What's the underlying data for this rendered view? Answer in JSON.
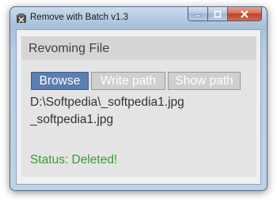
{
  "window": {
    "title": "Remove with Batch v1.3",
    "icon": "app-icon",
    "caption_buttons": {
      "minimize": "minimize-icon",
      "maximize": "maximize-icon",
      "close": "close-icon"
    }
  },
  "header": {
    "title": "Revoming File"
  },
  "buttons": {
    "browse": "Browse",
    "write_path": "Write path",
    "show_path": "Show path"
  },
  "file": {
    "full_path": "D:\\Softpedia\\_softpedia1.jpg",
    "name": "_softpedia1.jpg"
  },
  "status": {
    "text": "Status: Deleted!"
  },
  "colors": {
    "accent_button": "#5b7fb0",
    "status_text": "#3a9a33",
    "close_button": "#c9533c"
  }
}
